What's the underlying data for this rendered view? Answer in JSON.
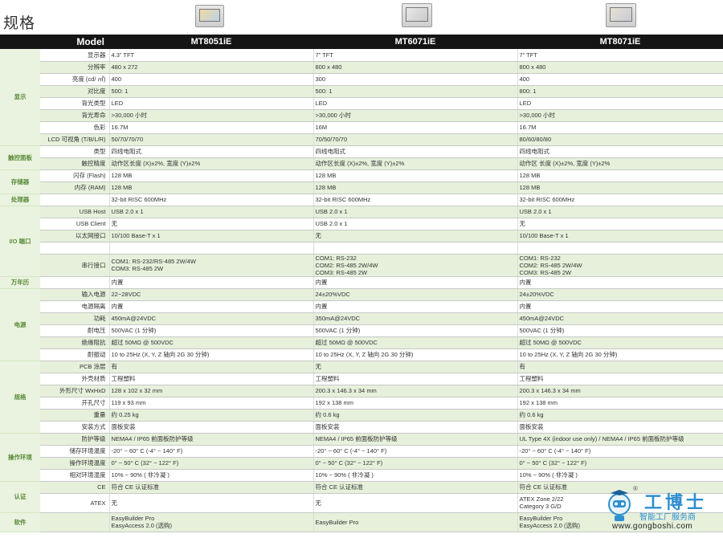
{
  "title": "规格",
  "header": {
    "model_label": "Model",
    "products": [
      "MT8051iE",
      "MT6071iE",
      "MT8071iE"
    ]
  },
  "rows": [
    {
      "cat": "显示",
      "cat_span": 8,
      "label": "显示器",
      "v": [
        "4.3”  TFT",
        "7”  TFT",
        "7”  TFT"
      ]
    },
    {
      "label": "分辨率",
      "v": [
        "480 x 272",
        "800 x 480",
        "800 x 480"
      ]
    },
    {
      "label": "亮度 (cd/ ㎡)",
      "v": [
        "400",
        "300",
        "400"
      ]
    },
    {
      "label": "对比度",
      "v": [
        "500: 1",
        "500: 1",
        "800: 1"
      ]
    },
    {
      "label": "背光类型",
      "v": [
        "LED",
        "LED",
        "LED"
      ]
    },
    {
      "label": "背光寿命",
      "v": [
        ">30,000 小时",
        ">30,000 小时",
        ">30,000 小时"
      ]
    },
    {
      "label": "色彩",
      "v": [
        "16.7M",
        "16M",
        "16.7M"
      ]
    },
    {
      "label": "LCD 可视角 (T/B/L/R)",
      "v": [
        "50/70/70/70",
        "70/50/70/70",
        "80/60/80/80"
      ]
    },
    {
      "cat": "触控面板",
      "cat_span": 2,
      "label": "类型",
      "v": [
        "四线电阻式",
        "四线电阻式",
        "四线电阻式"
      ]
    },
    {
      "label": "触控精度",
      "v": [
        "动作区长度 (X)±2%, 宽度 (Y)±2%",
        "动作区长度 (X)±2%, 宽度 (Y)±2%",
        "动作区 长度 (X)±2%, 宽度 (Y)±2%"
      ]
    },
    {
      "cat": "存储器",
      "cat_span": 2,
      "label": "闪存 (Flash)",
      "v": [
        "128 MB",
        "128 MB",
        "128 MB"
      ]
    },
    {
      "label": "内存 (RAM)",
      "v": [
        "128 MB",
        "128 MB",
        "128 MB"
      ]
    },
    {
      "cat": "处理器",
      "cat_span": 1,
      "label": "",
      "v": [
        "32-bit RISC 600MHz",
        "32-bit RISC 600MHz",
        "32-bit RISC 600MHz"
      ]
    },
    {
      "cat": "I/O 端口",
      "cat_span": 5,
      "label": "USB Host",
      "v": [
        "USB 2.0 x 1",
        "USB 2.0 x 1",
        "USB 2.0 x 1"
      ]
    },
    {
      "label": "USB Client",
      "v": [
        "无",
        "USB 2.0 x 1",
        "无"
      ]
    },
    {
      "label": "以太网接口",
      "v": [
        "10/100 Base-T x 1",
        "无",
        "10/100 Base-T x 1"
      ]
    },
    {
      "label": "",
      "v": [
        "",
        "",
        ""
      ]
    },
    {
      "label": "串行接口",
      "tall": true,
      "v": [
        "COM1: RS-232/RS-485 2W/4W\nCOM3: RS-485 2W",
        "COM1: RS-232\nCOM2: RS-485 2W/4W\nCOM3: RS-485 2W",
        "COM1: RS-232\nCOM2: RS-485 2W/4W\nCOM3: RS-485 2W"
      ]
    },
    {
      "cat": "万年历",
      "cat_span": 1,
      "label": "",
      "v": [
        "内置",
        "内置",
        "内置"
      ]
    },
    {
      "cat": "电源",
      "cat_span": 6,
      "label": "输入电源",
      "v": [
        "22~28VDC",
        "24±20%VDC",
        "24±20%VDC"
      ]
    },
    {
      "label": "电源隔离",
      "v": [
        "内置",
        "内置",
        "内置"
      ]
    },
    {
      "label": "功耗",
      "v": [
        "450mA@24VDC",
        "350mA@24VDC",
        "450mA@24VDC"
      ]
    },
    {
      "label": "耐电压",
      "v": [
        "500VAC (1 分钟)",
        "500VAC (1 分钟)",
        "500VAC (1 分钟)"
      ]
    },
    {
      "label": "绝缘阻抗",
      "v": [
        "超过 50MΩ  @ 500VDC",
        "超过 50MΩ  @ 500VDC",
        "超过 50MΩ  @ 500VDC"
      ]
    },
    {
      "label": "耐振动",
      "v": [
        "10 to 25Hz (X, Y, Z 轴向 2G 30 分钟)",
        "10 to 25Hz (X, Y, Z 轴向 2G 30 分钟)",
        "10 to 25Hz (X, Y, Z 轴向 2G 30 分钟)"
      ]
    },
    {
      "cat": "规格",
      "cat_span": 6,
      "label": "PCB 涂层",
      "v": [
        "有",
        "无",
        "有"
      ]
    },
    {
      "label": "外壳材质",
      "v": [
        "工程塑料",
        "工程塑料",
        "工程塑料"
      ]
    },
    {
      "label": "外形尺寸 WxHxD",
      "v": [
        "128 x 102 x 32 mm",
        "200.3 x 146.3 x 34 mm",
        "200.3 x 146.3 x 34 mm"
      ]
    },
    {
      "label": "开孔尺寸",
      "v": [
        "119 x 93 mm",
        "192 x 138 mm",
        "192 x 138 mm"
      ]
    },
    {
      "label": "重量",
      "v": [
        "约 0.25 kg",
        "约 0.6 kg",
        "约 0.6 kg"
      ]
    },
    {
      "label": "安装方式",
      "v": [
        "面板安装",
        "面板安装",
        "面板安装"
      ]
    },
    {
      "cat": "操作环境",
      "cat_span": 4,
      "label": "防护等级",
      "v": [
        "NEMA4 / IP65 前面板防护等级",
        "NEMA4 / IP65 前面板防护等级",
        "UL Type 4X (indoor use only) / NEMA4 / IP65 前面板防护等级"
      ]
    },
    {
      "label": "储存环境温度",
      "v": [
        "-20° ~ 60° C (-4° ~ 140° F)",
        "-20° ~ 60° C (-4° ~ 140° F)",
        "-20° ~ 60° C (-4° ~ 140° F)"
      ]
    },
    {
      "label": "操作环境温度",
      "v": [
        "0° ~ 50° C (32° ~ 122° F)",
        "0° ~ 50° C (32° ~ 122° F)",
        "0° ~ 50° C (32° ~ 122° F)"
      ]
    },
    {
      "label": "相对环境湿度",
      "v": [
        "10% ~ 90% ( 非冷凝 )",
        "10% ~ 90% ( 非冷凝 )",
        "10% ~ 90% ( 非冷凝 )"
      ]
    },
    {
      "cat": "认证",
      "cat_span": 2,
      "label": "CE",
      "v": [
        "符合 CE 认证标准",
        "符合 CE 认证标准",
        "符合 CE 认证标准"
      ]
    },
    {
      "label": "ATEX",
      "tall": true,
      "v": [
        "无",
        "无",
        "ATEX Zone 2/22\nCategory 3 G/D"
      ]
    },
    {
      "cat": "软件",
      "cat_span": 1,
      "label": "",
      "tall": true,
      "v": [
        "EasyBuilder Pro\nEasyAccess 2.0 (选购)",
        "EasyBuilder Pro",
        "EasyBuilder Pro\nEasyAccess 2.0 (选购)"
      ]
    }
  ],
  "watermark": {
    "brand": "工博士",
    "slogan": "智能工厂服务商",
    "url": "www.gongboshi.com",
    "reg": "®"
  }
}
